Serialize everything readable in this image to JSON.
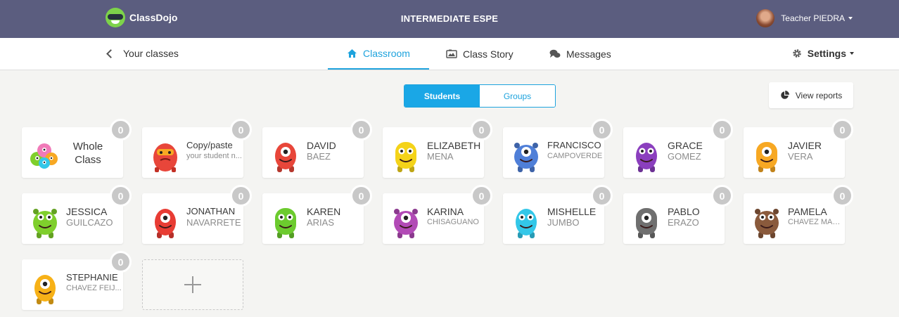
{
  "header": {
    "logo_text": "ClassDojo",
    "class_title": "INTERMEDIATE ESPE",
    "user_name": "Teacher PIEDRA"
  },
  "nav": {
    "back_label": "Your classes",
    "tabs": [
      {
        "label": "Classroom",
        "active": true
      },
      {
        "label": "Class Story",
        "active": false
      },
      {
        "label": "Messages",
        "active": false
      }
    ],
    "settings_label": "Settings"
  },
  "toggle": {
    "students": "Students",
    "groups": "Groups",
    "selected": "Students"
  },
  "view_reports": "View reports",
  "whole_class": {
    "line1": "Whole",
    "line2": "Class",
    "points": "0"
  },
  "copy_paste": {
    "line1": "Copy/paste",
    "line2": "your student n...",
    "points": "0"
  },
  "students": [
    {
      "first": "DAVID",
      "last": "BAEZ",
      "points": "0",
      "color": "#e8463a"
    },
    {
      "first": "ELIZABETH",
      "last": "MENA",
      "points": "0",
      "color": "#f4d319"
    },
    {
      "first": "FRANCISCO",
      "last": "CAMPOVERDE",
      "points": "0",
      "color": "#4f7fd8"
    },
    {
      "first": "GRACE",
      "last": "GOMEZ",
      "points": "0",
      "color": "#8b3fbe"
    },
    {
      "first": "JAVIER",
      "last": "VERA",
      "points": "0",
      "color": "#f7a823"
    },
    {
      "first": "JESSICA",
      "last": "GUILCAZO",
      "points": "0",
      "color": "#7fcf2c"
    },
    {
      "first": "JONATHAN",
      "last": "NAVARRETE",
      "points": "0",
      "color": "#e83c34"
    },
    {
      "first": "KAREN",
      "last": "ARIAS",
      "points": "0",
      "color": "#6ccb2e"
    },
    {
      "first": "KARINA",
      "last": "CHISAGUANO",
      "points": "0",
      "color": "#b24ab6"
    },
    {
      "first": "MISHELLE",
      "last": "JUMBO",
      "points": "0",
      "color": "#33c7e8"
    },
    {
      "first": "PABLO",
      "last": "ERAZO",
      "points": "0",
      "color": "#6f6f6f"
    },
    {
      "first": "PAMELA",
      "last": "CHAVEZ MAR...",
      "points": "0",
      "color": "#8a5a3c"
    },
    {
      "first": "STEPHANIE",
      "last": "CHAVEZ FEIJ...",
      "points": "0",
      "color": "#f7b117"
    }
  ],
  "add_student_icon": "plus-icon",
  "colors": {
    "header_bg": "#5b5d7f",
    "accent": "#1ea3dd",
    "badge": "#c8c8c8"
  }
}
